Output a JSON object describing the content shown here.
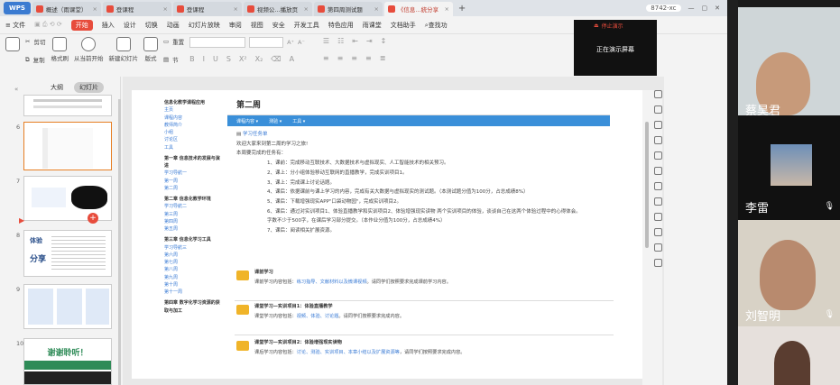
{
  "titlebar": {
    "app": "WPS",
    "tabs": [
      {
        "label": "概述（雨课堂）",
        "active": false
      },
      {
        "label": "登课程",
        "active": false
      },
      {
        "label": "登课程",
        "active": false
      },
      {
        "label": "视频公...播放页",
        "active": false
      },
      {
        "label": "第四周测试题",
        "active": false
      },
      {
        "label": "《信息...統分享",
        "active": true
      }
    ],
    "pill": "8742-xc",
    "plus": "+"
  },
  "menubar": {
    "file": "≡ 文件",
    "items": [
      "开始",
      "插入",
      "设计",
      "切换",
      "动画",
      "幻灯片放映",
      "审阅",
      "视图",
      "安全",
      "开发工具",
      "特色应用",
      "雨课堂",
      "文档助手"
    ],
    "active": "开始",
    "search": "查找功"
  },
  "ribbon": {
    "cut": "剪切",
    "copy": "复制",
    "format_painter": "格式刷",
    "play_from_current": "从当前开始",
    "new_slide": "新建幻灯片",
    "layout": "版式",
    "section": "节",
    "reset": "重置"
  },
  "presenting": {
    "top": "停止演示",
    "text": "正在演示屏幕"
  },
  "panel": {
    "tabs": [
      "大纲",
      "幻灯片"
    ],
    "active_tab": "幻灯片",
    "slide_numbers": [
      "",
      "6",
      "7",
      "8",
      "9",
      "10"
    ],
    "thumb_texts": {
      "slide8_word": "分享",
      "slide8_top": "体验",
      "slide10": "谢谢聆听！"
    }
  },
  "slide": {
    "nav": [
      {
        "text": "信息化教学课程应用",
        "h": true
      },
      {
        "text": "主页",
        "h": false
      },
      {
        "text": "课程内容",
        "h": false
      },
      {
        "text": "教师简介",
        "h": false
      },
      {
        "text": "小组",
        "h": false
      },
      {
        "text": "讨论区",
        "h": false
      },
      {
        "text": "工具",
        "h": false
      },
      {
        "text": "第一章 信息技术的发展与演进",
        "h": true
      },
      {
        "text": "学习导航一",
        "h": false
      },
      {
        "text": "第一周",
        "h": false
      },
      {
        "text": "第二周",
        "h": false
      },
      {
        "text": "第二章 信息化教学环境",
        "h": true
      },
      {
        "text": "学习导航二",
        "h": false
      },
      {
        "text": "第三周",
        "h": false
      },
      {
        "text": "第四周",
        "h": false
      },
      {
        "text": "第五周",
        "h": false
      },
      {
        "text": "第三章 信息化学习工具",
        "h": true
      },
      {
        "text": "学习导航三",
        "h": false
      },
      {
        "text": "第六周",
        "h": false
      },
      {
        "text": "第七周",
        "h": false
      },
      {
        "text": "第八周",
        "h": false
      },
      {
        "text": "第九周",
        "h": false
      },
      {
        "text": "第十周",
        "h": false
      },
      {
        "text": "第十一周",
        "h": false
      },
      {
        "text": "第四章 数字化学习资源的获取与加工",
        "h": true
      }
    ],
    "week": "第二周",
    "bluebar": [
      "课程内容 ▾",
      "测验 ▾",
      "工具 ▾"
    ],
    "task_title": "学习任务单",
    "task_intro": "欢迎大家来到第二周的学习之旅!",
    "task_sub": "本周要完成的任务有：",
    "task_items": [
      "1、课前：完成移动互联技术、大数据技术与虚拟现实、人工智能技术的相关预习。",
      "2、课上：分小组体验移动互联网的直播教学，完成实训项目1。",
      "3、课上：完成课上讨论话题。",
      "4、课后：依据课前与课上学习的内容，完成有关大数据与虚拟现实的测试题。（本测试题分值为100分，占总成绩8%）",
      "5、课后：下载增强现实APP\"口袋动物园\"，完成实训项目2。",
      "6、课后：通过对实训项目1、体验直播教学和实训项目2、体验增强现实读物 两个实训项目的体验，谈谈自己在这两个体验过程中的心得体会。",
      "字数不少于500字，在课后学习部分提交。（本作业分值为100分，占总成绩4%）",
      "7、课后：阅读相关扩展资源。"
    ],
    "sections": [
      {
        "title": "课前学习",
        "desc_pre": "课前学习内容包括：",
        "links": "练习指导、文献材料以及微课视频",
        "desc_post": "。请同学们按照要求完成课前学习内容。"
      },
      {
        "title": "课堂学习—实训项目1：体验直播教学",
        "desc_pre": "课堂学习内容包括：",
        "links": "视频、体验、讨论题",
        "desc_post": "。请同学们按照要求完成内容。"
      },
      {
        "title": "课堂学习—实训项目2：体验增强现实读物",
        "desc_pre": "课后学习内容包括：",
        "links": "讨论、测验、实训项目、本章小结以及扩展资源等",
        "desc_post": "，请同学们按照要求完成内容。"
      }
    ]
  },
  "participants": [
    {
      "name": "蔡昊君",
      "muted": false
    },
    {
      "name": "李雷",
      "muted": true
    },
    {
      "name": "刘智明",
      "muted": true
    },
    {
      "name": "",
      "muted": false
    }
  ],
  "colors": {
    "accent": "#e74c3c",
    "link": "#3a7bd5",
    "bar": "#3a8fd9",
    "folder": "#f0b429"
  }
}
